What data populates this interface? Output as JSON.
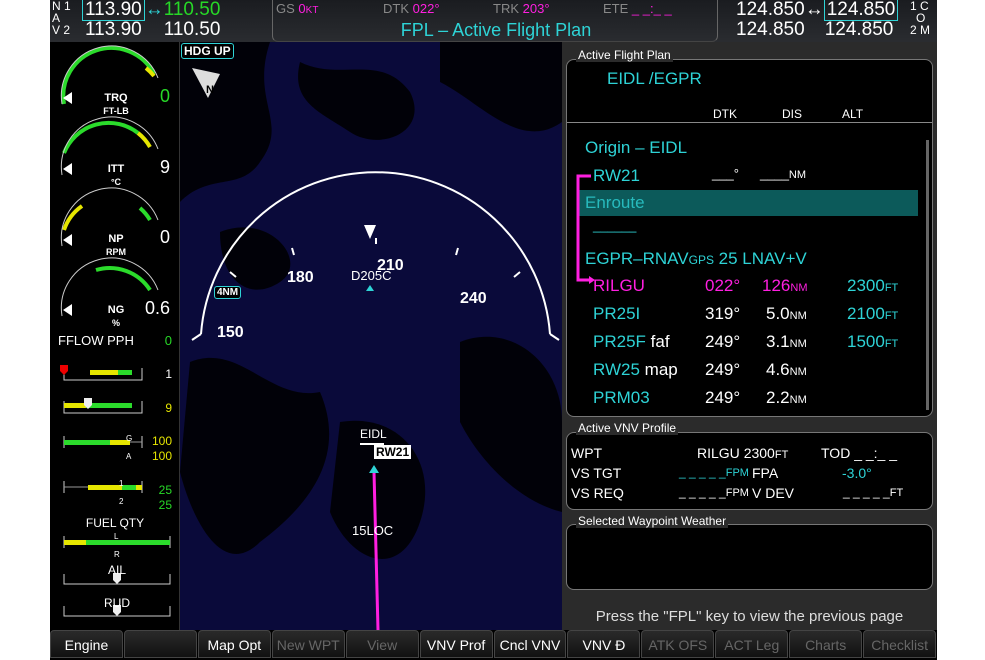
{
  "nav": {
    "label1": "N 1",
    "label2": "A",
    "label3": "V 2",
    "nav1_active": "113.90",
    "nav1_standby": "110.50",
    "nav2_active": "113.90",
    "nav2_standby": "110.50",
    "swap": "↔"
  },
  "com": {
    "com1_active": "124.850",
    "com1_standby": "124.850",
    "com2_active": "124.850",
    "com2_standby": "124.850",
    "label1": "1 C",
    "label2": "O",
    "label3": "2 M",
    "swap": "↔"
  },
  "status": {
    "gs_label": "GS",
    "gs_value": "0",
    "gs_unit": "KT",
    "dtk_label": "DTK",
    "dtk_value": "022°",
    "trk_label": "TRK",
    "trk_value": "203°",
    "ete_label": "ETE",
    "ete_value": "_ _:_ _",
    "page_title": "FPL – Active Flight Plan"
  },
  "engine": {
    "gauges": [
      {
        "name": "TRQ",
        "unit": "FT-LB",
        "value": "0"
      },
      {
        "name": "ITT",
        "unit": "°C",
        "value": "9"
      },
      {
        "name": "NP",
        "unit": "RPM",
        "value": "0"
      },
      {
        "name": "NG",
        "unit": "%",
        "value": "0.6"
      }
    ],
    "fflow_label": "FFLOW PPH",
    "fflow_value": "0",
    "bar1_value": "1",
    "bar2_value": "9",
    "bar3_values": [
      "100",
      "100"
    ],
    "bar3_markers": [
      "G",
      "A"
    ],
    "bar4_values": [
      "25",
      "25"
    ],
    "bar4_markers": [
      "1",
      "2"
    ],
    "fuel_qty_label": "FUEL QTY",
    "fuel_markers": [
      "L",
      "R"
    ],
    "ail_label": "AIL",
    "rud_label": "RUD"
  },
  "map": {
    "orientation": "HDG UP",
    "north": "N",
    "range": "4NM",
    "compass": [
      "150",
      "180",
      "210",
      "240"
    ],
    "waypoints": [
      "D205C",
      "EIDL",
      "RW21",
      "15LOC"
    ]
  },
  "fpl": {
    "panel_title": "Active Flight Plan",
    "route": "EIDL /EGPR",
    "headers": [
      "DTK",
      "DIS",
      "ALT"
    ],
    "origin": "Origin – EIDL",
    "rw21": {
      "name": "RW21",
      "dtk": "___°",
      "dis": "____",
      "dis_unit": "NM"
    },
    "enroute": "Enroute",
    "enroute_blank": "______",
    "approach": {
      "a": "EGPR–RNAV",
      "b": "GPS",
      "c": " 25 LNAV+V"
    },
    "legs": [
      {
        "name": "RILGU",
        "dtk": "022°",
        "dis": "126",
        "dis_unit": "NM",
        "alt": "2300",
        "alt_unit": "FT"
      },
      {
        "name": "PR25I",
        "dtk": "319°",
        "dis": "5.0",
        "dis_unit": "NM",
        "alt": "2100",
        "alt_unit": "FT"
      },
      {
        "name": "PR25F",
        "suffix": " faf",
        "dtk": "249°",
        "dis": "3.1",
        "dis_unit": "NM",
        "alt": "1500",
        "alt_unit": "FT"
      },
      {
        "name": "RW25",
        "suffix": " map",
        "dtk": "249°",
        "dis": "4.6",
        "dis_unit": "NM"
      },
      {
        "name": "PRM03",
        "dtk": "249°",
        "dis": "2.2",
        "dis_unit": "NM"
      }
    ]
  },
  "vnv": {
    "panel_title": "Active VNV Profile",
    "wpt_label": "WPT",
    "wpt": "RILGU",
    "wpt_alt": "2300",
    "ft": "FT",
    "tod_label": "TOD",
    "tod": "_ _:_ _",
    "vs_tgt_label": "VS TGT",
    "vs_tgt": "_ _ _ _ _",
    "fpm": "FPM",
    "fpa_label": "FPA",
    "fpa": "-3.0°",
    "vs_req_label": "VS REQ",
    "vs_req": "_ _ _ _ _",
    "vdev_label": "V DEV",
    "vdev": "_ _ _ _ _"
  },
  "weather": {
    "panel_title": "Selected Waypoint Weather"
  },
  "footer_msg": "Press the \"FPL\" key to view the previous page",
  "softkeys": [
    "Engine",
    "",
    "Map Opt",
    "New WPT",
    "View",
    "VNV Prof",
    "Cncl VNV",
    "VNV Đ",
    "ATK OFS",
    "ACT Leg",
    "Charts",
    "Checklist"
  ]
}
